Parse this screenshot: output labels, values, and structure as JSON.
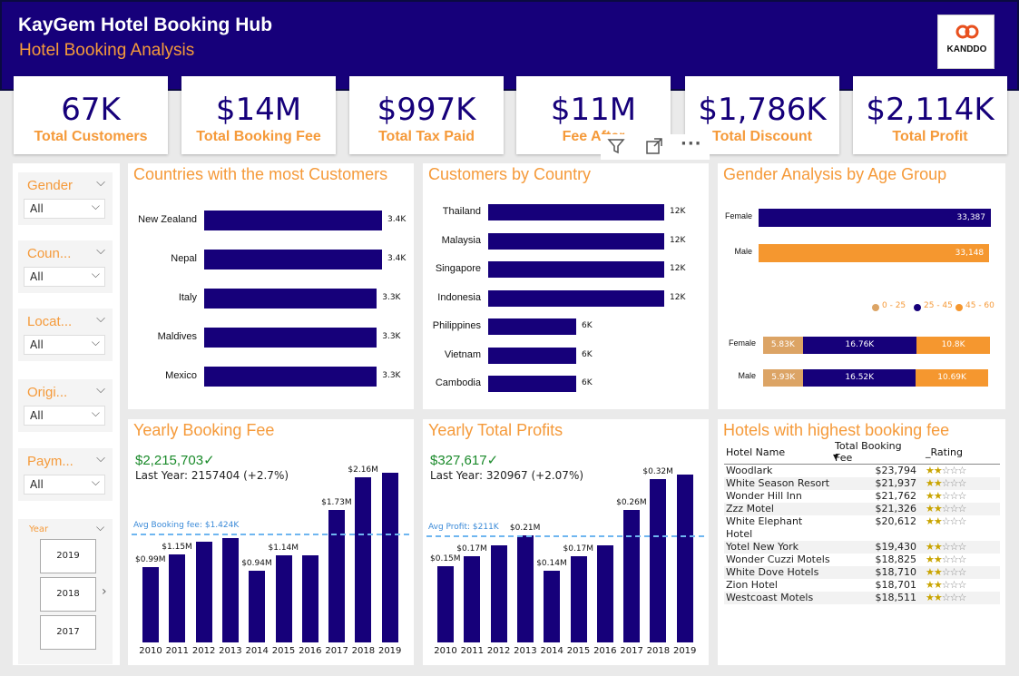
{
  "header": {
    "title": "KayGem Hotel Booking Hub",
    "subtitle": "Hotel Booking Analysis",
    "logo_text": "KANDDO"
  },
  "kpis": [
    {
      "value": "67K",
      "label": "Total Customers"
    },
    {
      "value": "$14M",
      "label": "Total Booking Fee"
    },
    {
      "value": "$997K",
      "label": "Total Tax Paid"
    },
    {
      "value": "$11M",
      "label": "Fee After"
    },
    {
      "value": "$1,786K",
      "label": "Total Discount"
    },
    {
      "value": "$2,114K",
      "label": "Total Profit"
    }
  ],
  "visual_header_icons": [
    "filter-icon",
    "focus-mode-icon",
    "more-options-icon"
  ],
  "slicers": [
    {
      "title": "Gender",
      "value": "All"
    },
    {
      "title": "Coun...",
      "value": "All"
    },
    {
      "title": "Locat...",
      "value": "All"
    },
    {
      "title": "Origi...",
      "value": "All"
    },
    {
      "title": "Paym...",
      "value": "All"
    }
  ],
  "year_slicer": {
    "title": "Year",
    "options": [
      "2019",
      "2018",
      "2017"
    ]
  },
  "charts": {
    "top_countries_title": "Countries with the most Customers",
    "by_country_title": "Customers by Country",
    "gender_age_title": "Gender Analysis by Age Group",
    "yearly_fee_title": "Yearly Booking Fee",
    "yearly_profit_title": "Yearly Total Profits",
    "hotels_title": "Hotels with highest booking fee"
  },
  "chart_data": [
    {
      "type": "bar",
      "orientation": "horizontal",
      "title": "Countries with the most Customers",
      "categories": [
        "New Zealand",
        "Nepal",
        "Italy",
        "Maldives",
        "Mexico"
      ],
      "values": [
        3400,
        3400,
        3300,
        3300,
        3300
      ],
      "labels": [
        "3.4K",
        "3.4K",
        "3.3K",
        "3.3K",
        "3.3K"
      ],
      "color": "#16007a"
    },
    {
      "type": "bar",
      "orientation": "horizontal",
      "title": "Customers by Country",
      "categories": [
        "Thailand",
        "Malaysia",
        "Singapore",
        "Indonesia",
        "Philippines",
        "Vietnam",
        "Cambodia"
      ],
      "values": [
        12000,
        12000,
        12000,
        12000,
        6000,
        6000,
        6000
      ],
      "labels": [
        "12K",
        "12K",
        "12K",
        "12K",
        "6K",
        "6K",
        "6K"
      ],
      "color": "#16007a"
    },
    {
      "type": "bar",
      "orientation": "horizontal",
      "title": "Gender Analysis by Age Group",
      "categories": [
        "Female",
        "Male"
      ],
      "values": [
        33387,
        33148
      ],
      "labels": [
        "33,387",
        "33,148"
      ],
      "colors": [
        "#16007a",
        "#f5972f"
      ]
    },
    {
      "type": "bar",
      "orientation": "horizontal",
      "stacked": true,
      "categories": [
        "Female",
        "Male"
      ],
      "legend": [
        "0 - 25",
        "25 - 45",
        "45 - 60"
      ],
      "legend_position": "top-right",
      "series": [
        {
          "name": "0 - 25",
          "values": [
            5830,
            5930
          ],
          "labels": [
            "5.83K",
            "5.93K"
          ],
          "color": "#dca465"
        },
        {
          "name": "25 - 45",
          "values": [
            16760,
            16520
          ],
          "labels": [
            "16.76K",
            "16.52K"
          ],
          "color": "#16007a"
        },
        {
          "name": "45 - 60",
          "values": [
            10800,
            10690
          ],
          "labels": [
            "10.8K",
            "10.69K"
          ],
          "color": "#f5972f"
        }
      ]
    },
    {
      "type": "bar",
      "title": "Yearly Booking Fee",
      "categories": [
        "2010",
        "2011",
        "2012",
        "2013",
        "2014",
        "2015",
        "2016",
        "2017",
        "2018",
        "2019"
      ],
      "values": [
        0.99,
        1.15,
        1.32,
        1.37,
        0.94,
        1.14,
        1.14,
        1.73,
        2.16,
        2.22
      ],
      "labels": [
        "$0.99M",
        "$1.15M",
        "",
        "",
        "$0.94M",
        "$1.14M",
        "",
        "$1.73M",
        "$2.16M",
        ""
      ],
      "unit": "$M",
      "ylim": [
        0,
        2.4
      ],
      "avg_line": {
        "value": 1.424,
        "label": "Avg Booking fee: $1.424K"
      },
      "kpi": {
        "value": "$2,215,703✓",
        "subtext": "Last Year: 2157404 (+2.7%)"
      }
    },
    {
      "type": "bar",
      "title": "Yearly Total Profits",
      "categories": [
        "2010",
        "2011",
        "2012",
        "2013",
        "2014",
        "2015",
        "2016",
        "2017",
        "2018",
        "2019"
      ],
      "values": [
        0.15,
        0.17,
        0.19,
        0.21,
        0.14,
        0.17,
        0.19,
        0.26,
        0.32,
        0.33
      ],
      "labels": [
        "$0.15M",
        "$0.17M",
        "",
        "$0.21M",
        "$0.14M",
        "$0.17M",
        "",
        "$0.26M",
        "$0.32M",
        ""
      ],
      "unit": "$M",
      "ylim": [
        0,
        0.36
      ],
      "avg_line": {
        "value": 0.211,
        "label": "Avg Profit: $211K"
      },
      "kpi": {
        "value": "$327,617✓",
        "subtext": "Last Year: 320967 (+2.07%)"
      }
    }
  ],
  "hotels_table": {
    "columns": [
      "Hotel Name",
      "Total Booking Fee",
      "_Rating"
    ],
    "rows": [
      {
        "name": "Woodlark",
        "fee": "$23,794",
        "rating": 2
      },
      {
        "name": "White Season Resort",
        "fee": "$21,937",
        "rating": 2
      },
      {
        "name": "Wonder Hill Inn",
        "fee": "$21,762",
        "rating": 2
      },
      {
        "name": "Zzz Motel",
        "fee": "$21,326",
        "rating": 2
      },
      {
        "name": "White Elephant Hotel",
        "fee": "$20,612",
        "rating": 2
      },
      {
        "name": "Yotel New York",
        "fee": "$19,430",
        "rating": 2
      },
      {
        "name": "Wonder Cuzzi Motels",
        "fee": "$18,825",
        "rating": 2
      },
      {
        "name": "White Dove Hotels",
        "fee": "$18,710",
        "rating": 2
      },
      {
        "name": "Zion Hotel",
        "fee": "$18,701",
        "rating": 2
      },
      {
        "name": "Westcoast Motels",
        "fee": "$18,511",
        "rating": 2
      }
    ]
  }
}
